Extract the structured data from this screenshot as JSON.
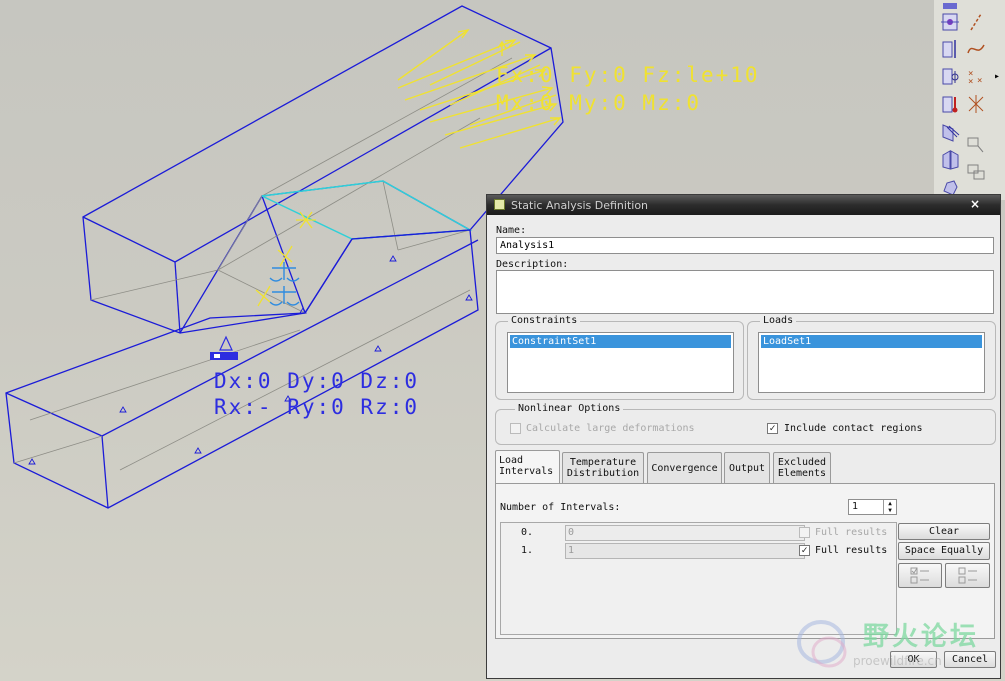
{
  "model": {
    "load_label_line1": "Fx:0 Fy:0 Fz:le+10",
    "load_label_line2": "Mx:0 My:0 Mz:0",
    "constraint_label_line1": "Dx:0 Dy:0 Dz:0",
    "constraint_label_line2": "Rx:- Ry:0 Rz:0"
  },
  "colors": {
    "wireframe": "#1b1bd8",
    "load": "#f0e230",
    "contact": "#2fd0d8",
    "selection": "#3a94dc"
  },
  "toolbar": {
    "icons": [
      "mass-icon",
      "datum-line-icon",
      "surface-region-icon",
      "sketch-curve-icon",
      "volume-region-icon",
      "datum-point-icon",
      "temperature-icon",
      "coordinate-system-icon",
      "shell-pair-icon",
      "beam-icon",
      "midsurface-icon",
      "spring-icon",
      "rigid-link-icon",
      "weld-icon"
    ],
    "expand_glyph": "▸"
  },
  "dialog": {
    "title": "Static Analysis Definition",
    "close_glyph": "×",
    "name_label": "Name:",
    "name_value": "Analysis1",
    "description_label": "Description:",
    "description_value": "",
    "constraints_title": "Constraints",
    "constraints_items": [
      "ConstraintSet1"
    ],
    "loads_title": "Loads",
    "loads_items": [
      "LoadSet1"
    ],
    "nonlinear_title": "Nonlinear Options",
    "large_deformations_label": "Calculate large deformations",
    "large_deformations_checked": false,
    "contact_label": "Include contact regions",
    "contact_checked": true,
    "tabs": [
      {
        "line1": "Load",
        "line2": "Intervals",
        "active": true
      },
      {
        "line1": "Temperature",
        "line2": "Distribution",
        "active": false
      },
      {
        "line1": "Convergence",
        "line2": "",
        "active": false
      },
      {
        "line1": "Output",
        "line2": "",
        "active": false
      },
      {
        "line1": "Excluded",
        "line2": "Elements",
        "active": false
      }
    ],
    "intervals_label": "Number of Intervals:",
    "intervals_value": "1",
    "intervals": [
      {
        "index": "0.",
        "value": "0",
        "full_results_label": "Full results",
        "checked": false,
        "enabled": false
      },
      {
        "index": "1.",
        "value": "1",
        "full_results_label": "Full results",
        "checked": true,
        "enabled": true
      }
    ],
    "clear_label": "Clear",
    "space_equally_label": "Space Equally",
    "ok_label": "OK",
    "cancel_label": "Cancel"
  },
  "watermark": {
    "text": "野火论坛",
    "url": "proewildfire.cn"
  }
}
